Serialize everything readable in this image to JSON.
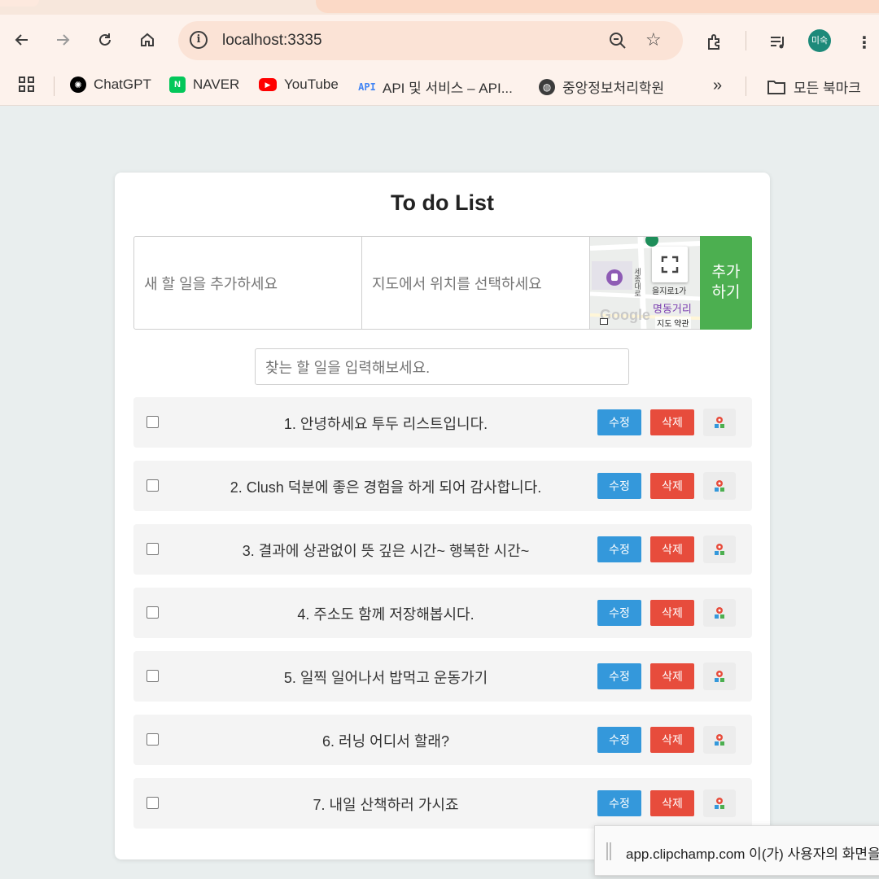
{
  "browser": {
    "url": "localhost:3335",
    "profile_initials": "미숙",
    "bookmarks": [
      {
        "label": "ChatGPT",
        "icon": "chatgpt-icon",
        "color": "#000000"
      },
      {
        "label": "NAVER",
        "icon": "naver-icon",
        "color": "#03c75a"
      },
      {
        "label": "YouTube",
        "icon": "youtube-icon",
        "color": "#ff0000"
      },
      {
        "label": "API 및 서비스 – API...",
        "icon": "api-icon",
        "color": "#4285f4"
      },
      {
        "label": "중앙정보처리학원",
        "icon": "globe-icon",
        "color": "#3c3c3c"
      }
    ],
    "all_bookmarks_label": "모든 북마크",
    "more_label": "»"
  },
  "app": {
    "title": "To do List",
    "new_todo_placeholder": "새 할 일을 추가하세요",
    "location_placeholder": "지도에서 위치를 선택하세요",
    "add_button_line1": "추가",
    "add_button_line2": "하기",
    "search_placeholder": "찾는 할 일을 입력해보세요.",
    "map": {
      "labels": [
        "을지로1가",
        "명동거리",
        "세종대로",
        "지도 약관",
        "Google"
      ]
    },
    "edit_label": "수정",
    "delete_label": "삭제",
    "colors": {
      "edit": "#3498db",
      "delete": "#e74c3c",
      "add": "#4caf50"
    },
    "todos": [
      {
        "text": "1. 안녕하세요 투두 리스트입니다.",
        "checked": false
      },
      {
        "text": "2. Clush 덕분에 좋은 경험을 하게 되어 감사합니다.",
        "checked": false
      },
      {
        "text": "3. 결과에 상관없이 뜻 깊은 시간~ 행복한 시간~",
        "checked": false
      },
      {
        "text": "4. 주소도 함께 저장해봅시다.",
        "checked": false
      },
      {
        "text": "5. 일찍 일어나서 밥먹고 운동가기",
        "checked": false
      },
      {
        "text": "6. 러닝 어디서 할래?",
        "checked": false
      },
      {
        "text": "7. 내일 산책하러 가시죠",
        "checked": false
      }
    ]
  },
  "notification": {
    "text": "app.clipchamp.com 이(가) 사용자의 화면을"
  }
}
